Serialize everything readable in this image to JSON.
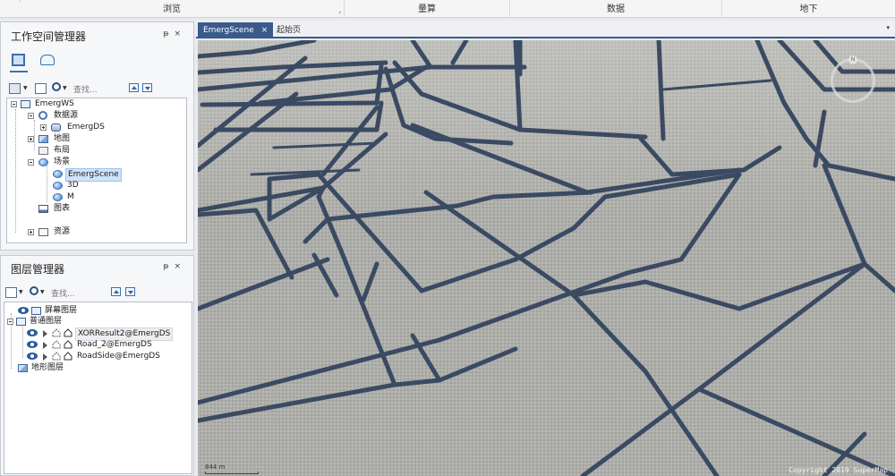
{
  "ribbon": {
    "groups": [
      "浏览",
      "量算",
      "数据",
      "地下"
    ],
    "dot": "˙"
  },
  "workspace_panel": {
    "title": "工作空间管理器",
    "pin_icon": "pin-icon",
    "close_icon": "close-icon",
    "search_placeholder": "查找...",
    "tree": {
      "root": "EmergWS",
      "datasources": "数据源",
      "datasource_item": "EmergDS",
      "maps": "地图",
      "layouts": "布局",
      "scenes": "场景",
      "scene_items": [
        "EmergScene",
        "3D",
        "M"
      ],
      "charts": "图表",
      "resources": "资源"
    }
  },
  "layer_panel": {
    "title": "图层管理器",
    "search_placeholder": "查找...",
    "tree": {
      "screen_layers": "屏幕图层",
      "normal_layers": "普通图层",
      "layers": [
        "XORResult2@EmergDS",
        "Road_2@EmergDS",
        "RoadSide@EmergDS"
      ],
      "terrain_layers": "地形图层"
    }
  },
  "doc_tabs": {
    "active": "EmergScene",
    "inactive": "起始页",
    "close_glyph": "×",
    "menu_glyph": "▾"
  },
  "scene": {
    "compass_label": "N",
    "copyright": "Copyright 2019 SuperMap",
    "scale_text": "844 m"
  },
  "colors": {
    "accent": "#3a5a8c",
    "road": "#3b4a63",
    "ground": "#a9aaa5"
  }
}
